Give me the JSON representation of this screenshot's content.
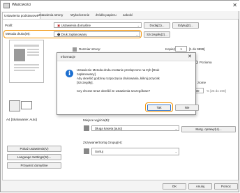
{
  "window": {
    "title": "Właściwości"
  },
  "tabs": [
    "Ustawienia podstawowe",
    "Ustawienia strony",
    "Wykończenie",
    "Źródło papieru",
    "Jakość"
  ],
  "profile": {
    "label": "Profil:",
    "value": "Ustawienia domyślne",
    "add": "Dodaj(1)...",
    "edit": "Edytuj(2)..."
  },
  "output": {
    "label": "Metoda druku(M):",
    "value": "Druk zaplanowany",
    "details": "Szczegóły(2)..."
  },
  "page_size": {
    "label": "Rozmiar strony:"
  },
  "copies": {
    "label": "Kopie(G):",
    "value": "1",
    "range": "[1 do 9999]"
  },
  "orientation": {
    "portrait": "Pionowa",
    "landscape": "Pozioma"
  },
  "side_label": "ziome",
  "zoom": {
    "value": "100",
    "range": "% [25 do 200]"
  },
  "preview": {
    "caption": "A4 [Skalowanie: Auto]"
  },
  "paper_source": {
    "label": "Miejsce wyjścia(B):",
    "value": "Długa kaseta [auto]"
  },
  "mgmt_button": "Marg. oprawy(U)...",
  "staple": {
    "label": "Zszywanie/Sortuj.Grupuj(H):",
    "value": "Sortuj"
  },
  "left_buttons": [
    "Pokaż ustawienia(V)",
    "Language Settings(W)...",
    "Przywróć domyślne"
  ],
  "footer": {
    "ok": "OK",
    "cancel": "Anuluj",
    "help": "Pomoc"
  },
  "dialog": {
    "title": "Informacje",
    "lines": [
      "Ustawienie Metoda druku zostanie przełączone na tryb [Druk",
      "zaplanowany].",
      "Aby określić godzinę rozpoczęcia drukowania, kliknij przycisk",
      "[Szczegóły].",
      "Czy chcesz teraz określić te ustawienia szczegółowe?"
    ],
    "yes": "Tak",
    "no": "Nie"
  },
  "colors": {
    "highlight": "#f29100",
    "info_icon": "#1c6fd0"
  }
}
